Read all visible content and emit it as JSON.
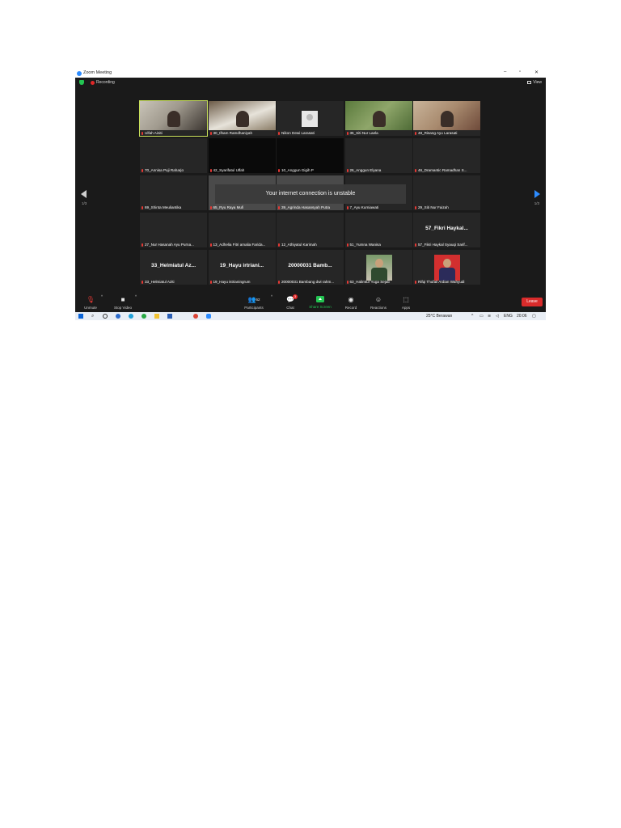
{
  "window": {
    "title": "Zoom Meeting",
    "min": "–",
    "max": "▫",
    "close": "✕"
  },
  "meeting_bar": {
    "recording": "Recording",
    "view": "View"
  },
  "toast": "Your internet connection is unstable",
  "pager": {
    "left": "1/3",
    "right": "1/3"
  },
  "tiles": [
    {
      "name": "Ulfah Ainiti",
      "active": true,
      "bg": "video-a",
      "center": ""
    },
    {
      "name": "30_Ilham Ramdhaniyah",
      "bg": "video-b",
      "center": ""
    },
    {
      "name": "Nikon Dewi Larasati",
      "bg": "avatar",
      "center": ""
    },
    {
      "name": "35_Siti Nur Laela",
      "bg": "video-c",
      "center": ""
    },
    {
      "name": "48_Risang Ayu Larasati",
      "bg": "video-d",
      "center": ""
    },
    {
      "name": "70_Annisa Puji Raharjo",
      "bg": "",
      "center": ""
    },
    {
      "name": "42_Syarifatul Ulfah",
      "bg": "black",
      "center": ""
    },
    {
      "name": "10_Anggun Gigih P",
      "bg": "black",
      "center": ""
    },
    {
      "name": "26_Anggun Elyana",
      "bg": "",
      "center": ""
    },
    {
      "name": "46_Dramantic Ramadhan S...",
      "bg": "",
      "center": ""
    },
    {
      "name": "69_Shinta Meuliantika",
      "bg": "",
      "center": ""
    },
    {
      "name": "65_Ryu Raya Mufi",
      "bg": "grey",
      "center": ""
    },
    {
      "name": "39_Agrinda Hasansyah Putra",
      "bg": "grey",
      "center": ""
    },
    {
      "name": "7_Ayu Kurniawati",
      "bg": "",
      "center": ""
    },
    {
      "name": "29_Siti Nur Faizah",
      "bg": "",
      "center": ""
    },
    {
      "name": "27_Nur Hasanah Ayu Purna...",
      "bg": "",
      "center": ""
    },
    {
      "name": "13_Adhelia Fitri amalia Farida...",
      "bg": "",
      "center": ""
    },
    {
      "name": "12_Athiyatul Karimah",
      "bg": "",
      "center": ""
    },
    {
      "name": "51_Yumna Wanisa",
      "bg": "",
      "center": ""
    },
    {
      "name": "57_Fikri Haykal Syauqi Sarif...",
      "bg": "",
      "center": "57_Fikri  Haykal..."
    },
    {
      "name": "33_Helmiatul Aziti",
      "bg": "",
      "center": "33_Helmiatul  Az..."
    },
    {
      "name": "19_Hayu istrianingrum",
      "bg": "",
      "center": "19_Hayu  irtriani..."
    },
    {
      "name": "20000031 Bambang dwi rahm...",
      "bg": "",
      "center": "20000031 Bamb..."
    },
    {
      "name": "63_Halimtur Yuga Sejati",
      "bg": "thumb-green",
      "center": ""
    },
    {
      "name": "Rifqi Thufail Ardian Wahyudi",
      "bg": "thumb-red",
      "center": ""
    }
  ],
  "toolbar": {
    "unmute": "Unmute",
    "stop_video": "Stop Video",
    "participants": "Participants",
    "participants_count": "62",
    "chat": "Chat",
    "chat_badge": "3",
    "share_screen": "Share Screen",
    "record": "Record",
    "reactions": "Reactions",
    "apps": "Apps",
    "leave": "Leave"
  },
  "taskbar": {
    "weather": "25°C  Berawan",
    "lang": "ENG",
    "time": "20:06"
  },
  "colors": {
    "accent": "#2d8cff",
    "leave": "#d92b2b",
    "share": "#23c552",
    "active_border": "#c8e05a"
  }
}
